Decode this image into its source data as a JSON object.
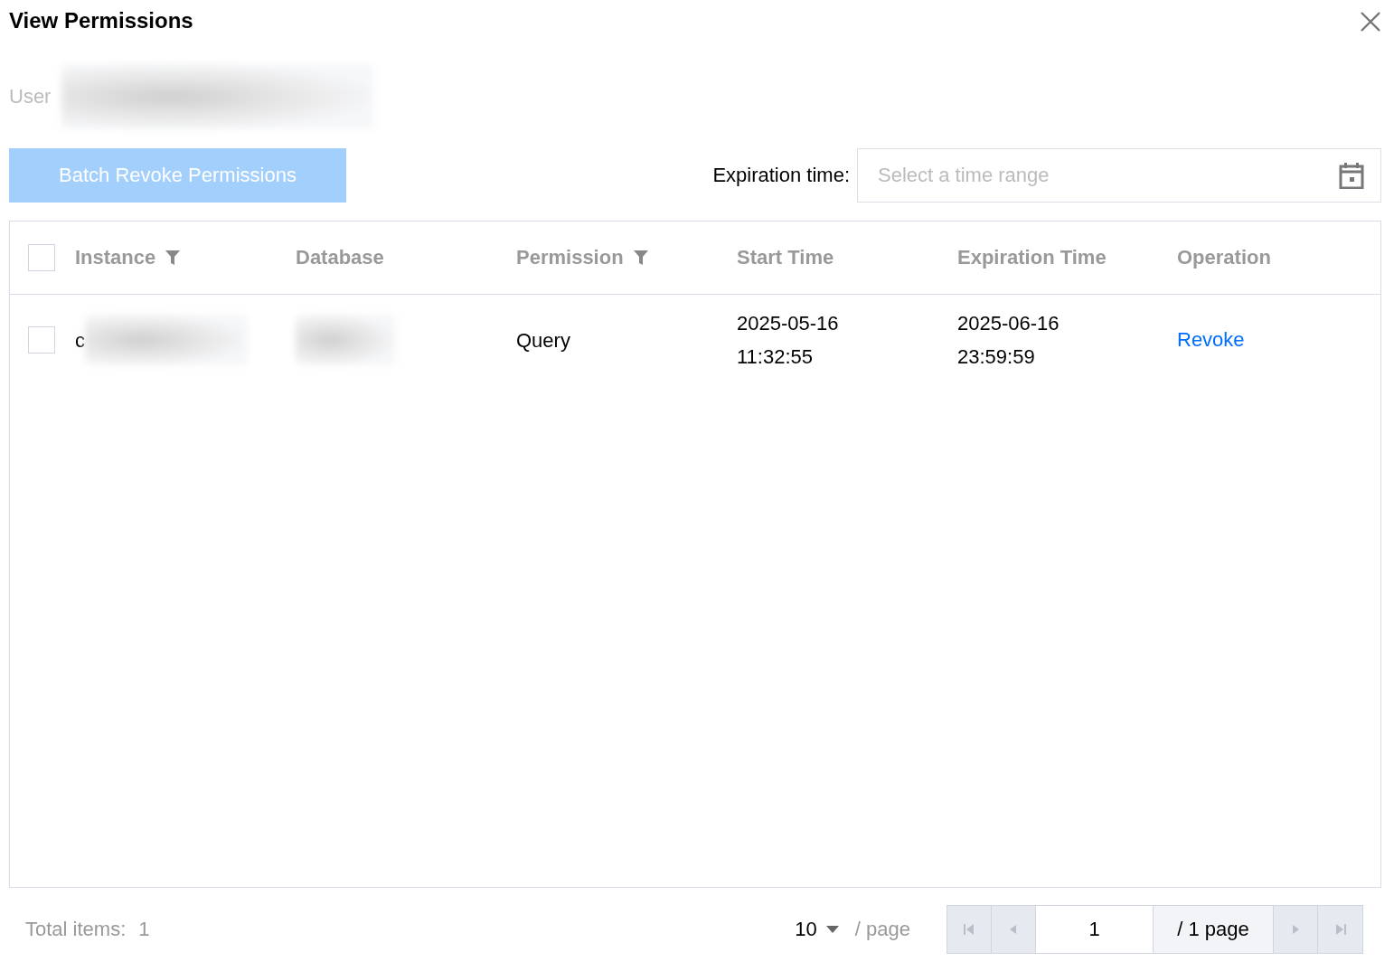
{
  "dialog": {
    "title": "View Permissions"
  },
  "user": {
    "label": "User"
  },
  "toolbar": {
    "batch_button": {
      "label": "Batch Revoke Permissions",
      "disabled": true
    },
    "filter_label": "Expiration time:",
    "range_field": {
      "placeholder": "Select a time range"
    }
  },
  "table": {
    "select_all": {
      "checked": false
    },
    "columns": [
      {
        "label": "Instance",
        "filterable": true
      },
      {
        "label": "Database",
        "filterable": false
      },
      {
        "label": "Permission",
        "filterable": true
      },
      {
        "label": "Start Time",
        "filterable": false
      },
      {
        "label": "Expiration Time",
        "filterable": false
      },
      {
        "label": "Operation",
        "filterable": false
      }
    ],
    "rows": [
      {
        "checked": false,
        "instance": "c",
        "permission": "Query",
        "start_time": [
          "2025-05-16",
          "11:32:55"
        ],
        "expiration_time": [
          "2025-06-16",
          "23:59:59"
        ],
        "operation": "Revoke"
      }
    ]
  },
  "footer": {
    "total_label": "Total items:",
    "total": "1",
    "page_size": "10",
    "page_size_unit": "/ page",
    "page": "1",
    "page_count": "/ 1 page",
    "nav": [
      {
        "kind": "first",
        "disabled": true
      },
      {
        "kind": "prev",
        "disabled": true
      },
      {
        "kind": "next",
        "disabled": true
      },
      {
        "kind": "last",
        "disabled": true
      }
    ]
  }
}
